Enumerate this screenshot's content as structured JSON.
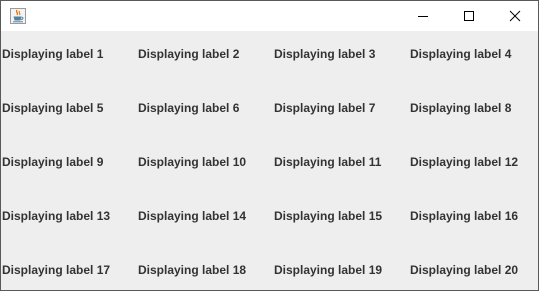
{
  "window": {
    "app_icon": "java-cup-icon",
    "controls": {
      "minimize_icon": "minimize-icon",
      "maximize_icon": "maximize-icon",
      "close_icon": "close-icon"
    }
  },
  "labels": [
    "Displaying label 1",
    "Displaying label 2",
    "Displaying label 3",
    "Displaying label 4",
    "Displaying label 5",
    "Displaying label 6",
    "Displaying label 7",
    "Displaying label 8",
    "Displaying label 9",
    "Displaying label 10",
    "Displaying label 11",
    "Displaying label 12",
    "Displaying label 13",
    "Displaying label 14",
    "Displaying label 15",
    "Displaying label 16",
    "Displaying label 17",
    "Displaying label 18",
    "Displaying label 19",
    "Displaying label 20"
  ]
}
